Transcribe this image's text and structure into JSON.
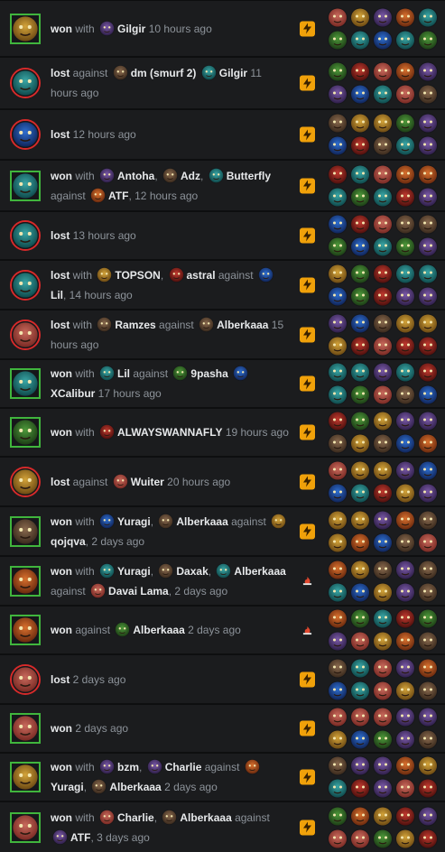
{
  "colors": {
    "won": "#40b53d",
    "lost": "#d62a2a",
    "bg": "#1b1c1e",
    "badge": "#f0a10a"
  },
  "matches": [
    {
      "result": "won",
      "avatar": "golden-monkey-hero",
      "badge": "lightning",
      "parts": [
        {
          "t": "won",
          "b": 1
        },
        {
          "t": " with "
        },
        {
          "i": "purple"
        },
        {
          "t": "Gilgir",
          "b": 1
        },
        {
          "t": " 10 hours ago"
        }
      ]
    },
    {
      "result": "lost",
      "avatar": "green-crab-hero",
      "badge": "lightning",
      "parts": [
        {
          "t": "lost",
          "b": 1
        },
        {
          "t": " against "
        },
        {
          "i": "brown"
        },
        {
          "t": "dm (smurf 2)",
          "b": 1
        },
        {
          "t": " "
        },
        {
          "i": "teal"
        },
        {
          "t": "Gilgir",
          "b": 1
        },
        {
          "t": " 11 hours ago"
        }
      ]
    },
    {
      "result": "lost",
      "avatar": "blue-mask-hero",
      "badge": "lightning",
      "parts": [
        {
          "t": "lost",
          "b": 1
        },
        {
          "t": " 12 hours ago"
        }
      ]
    },
    {
      "result": "won",
      "avatar": "teal-beast-hero",
      "badge": "lightning",
      "parts": [
        {
          "t": "won",
          "b": 1
        },
        {
          "t": " with "
        },
        {
          "i": "purple"
        },
        {
          "t": "Antoha",
          "b": 1
        },
        {
          "t": ", "
        },
        {
          "i": "brown"
        },
        {
          "t": "Adz",
          "b": 1
        },
        {
          "t": ", "
        },
        {
          "i": "teal"
        },
        {
          "t": "Butterfly",
          "b": 1
        },
        {
          "t": " against "
        },
        {
          "i": "orange"
        },
        {
          "t": "ATF",
          "b": 1
        },
        {
          "t": ", 12 hours ago"
        }
      ]
    },
    {
      "result": "lost",
      "avatar": "teal-spider-hero",
      "badge": "lightning",
      "parts": [
        {
          "t": "lost",
          "b": 1
        },
        {
          "t": " 13 hours ago"
        }
      ]
    },
    {
      "result": "lost",
      "avatar": "green-crab-hero",
      "badge": "lightning",
      "parts": [
        {
          "t": "lost",
          "b": 1
        },
        {
          "t": " with "
        },
        {
          "i": "gold"
        },
        {
          "t": "TOPSON",
          "b": 1
        },
        {
          "t": ", "
        },
        {
          "i": "red"
        },
        {
          "t": "astral",
          "b": 1
        },
        {
          "t": " against "
        },
        {
          "i": "blue"
        },
        {
          "t": "Lil",
          "b": 1
        },
        {
          "t": ", 14 hours ago"
        }
      ]
    },
    {
      "result": "lost",
      "avatar": "pink-maw-hero",
      "badge": "lightning",
      "parts": [
        {
          "t": "lost",
          "b": 1
        },
        {
          "t": " with "
        },
        {
          "i": "brown"
        },
        {
          "t": "Ramzes",
          "b": 1
        },
        {
          "t": " against "
        },
        {
          "i": "brown"
        },
        {
          "t": "Alberkaaa",
          "b": 1
        },
        {
          "t": " 15 hours ago"
        }
      ]
    },
    {
      "result": "won",
      "avatar": "green-crab-hero",
      "badge": "lightning",
      "parts": [
        {
          "t": "won",
          "b": 1
        },
        {
          "t": " with "
        },
        {
          "i": "teal"
        },
        {
          "t": "Lil",
          "b": 1
        },
        {
          "t": " against "
        },
        {
          "i": "green"
        },
        {
          "t": "9pasha",
          "b": 1
        },
        {
          "t": " "
        },
        {
          "i": "blue"
        },
        {
          "t": "XCalibur",
          "b": 1
        },
        {
          "t": " 17 hours ago"
        }
      ]
    },
    {
      "result": "won",
      "avatar": "green-mask-hero",
      "badge": "lightning",
      "parts": [
        {
          "t": "won",
          "b": 1
        },
        {
          "t": " with "
        },
        {
          "i": "red"
        },
        {
          "t": "ALWAYSWANNAFLY",
          "b": 1
        },
        {
          "t": " 19 hours ago"
        }
      ]
    },
    {
      "result": "lost",
      "avatar": "golden-monkey-hero",
      "badge": "lightning",
      "parts": [
        {
          "t": "lost",
          "b": 1
        },
        {
          "t": " against "
        },
        {
          "i": "pink"
        },
        {
          "t": "Wuiter",
          "b": 1
        },
        {
          "t": " 20 hours ago"
        }
      ]
    },
    {
      "result": "won",
      "avatar": "helmet-hero",
      "badge": "lightning",
      "parts": [
        {
          "t": "won",
          "b": 1
        },
        {
          "t": " with "
        },
        {
          "i": "blue"
        },
        {
          "t": "Yuragi",
          "b": 1
        },
        {
          "t": ", "
        },
        {
          "i": "brown"
        },
        {
          "t": "Alberkaaa",
          "b": 1
        },
        {
          "t": " against "
        },
        {
          "i": "gold"
        },
        {
          "t": "qojqva",
          "b": 1
        },
        {
          "t": ", 2 days ago"
        }
      ]
    },
    {
      "result": "won",
      "avatar": "elf-hero",
      "badge": "fire",
      "parts": [
        {
          "t": "won",
          "b": 1
        },
        {
          "t": " with "
        },
        {
          "i": "teal"
        },
        {
          "t": "Yuragi",
          "b": 1
        },
        {
          "t": ", "
        },
        {
          "i": "brown"
        },
        {
          "t": "Daxak",
          "b": 1
        },
        {
          "t": ", "
        },
        {
          "i": "teal"
        },
        {
          "t": "Alberkaaa",
          "b": 1
        },
        {
          "t": " against "
        },
        {
          "i": "pink"
        },
        {
          "t": "Davai Lama",
          "b": 1
        },
        {
          "t": ", 2 days ago"
        }
      ]
    },
    {
      "result": "won",
      "avatar": "elf-hero",
      "badge": "fire",
      "parts": [
        {
          "t": "won",
          "b": 1
        },
        {
          "t": " against "
        },
        {
          "i": "green"
        },
        {
          "t": "Alberkaaa",
          "b": 1
        },
        {
          "t": " 2 days ago"
        }
      ]
    },
    {
      "result": "lost",
      "avatar": "pink-maw-hero",
      "badge": "lightning",
      "parts": [
        {
          "t": "lost",
          "b": 1
        },
        {
          "t": " 2 days ago"
        }
      ]
    },
    {
      "result": "won",
      "avatar": "pink-maw-hero",
      "badge": "lightning",
      "parts": [
        {
          "t": "won",
          "b": 1
        },
        {
          "t": " 2 days ago"
        }
      ]
    },
    {
      "result": "won",
      "avatar": "golden-monkey-hero",
      "badge": "lightning",
      "parts": [
        {
          "t": "won",
          "b": 1
        },
        {
          "t": " with "
        },
        {
          "i": "purple"
        },
        {
          "t": "bzm",
          "b": 1
        },
        {
          "t": ", "
        },
        {
          "i": "purple"
        },
        {
          "t": "Charlie",
          "b": 1
        },
        {
          "t": " against "
        },
        {
          "i": "orange"
        },
        {
          "t": "Yuragi",
          "b": 1
        },
        {
          "t": ", "
        },
        {
          "i": "brown"
        },
        {
          "t": "Alberkaaa",
          "b": 1
        },
        {
          "t": " 2 days ago"
        }
      ]
    },
    {
      "result": "won",
      "avatar": "pink-maw-hero",
      "badge": "lightning",
      "parts": [
        {
          "t": "won",
          "b": 1
        },
        {
          "t": " with "
        },
        {
          "i": "pink"
        },
        {
          "t": "Charlie",
          "b": 1
        },
        {
          "t": ", "
        },
        {
          "i": "brown"
        },
        {
          "t": "Alberkaaa",
          "b": 1
        },
        {
          "t": " against "
        },
        {
          "i": "purple"
        },
        {
          "t": "ATF",
          "b": 1
        },
        {
          "t": ", 3 days ago"
        }
      ]
    }
  ],
  "hero_grids": [
    [
      "pink",
      "gold",
      "purple",
      "orange",
      "teal",
      "green",
      "teal",
      "blue",
      "teal",
      "green"
    ],
    [
      "green",
      "red",
      "pink",
      "orange",
      "purple",
      "purple",
      "blue",
      "teal",
      "pink",
      "brown"
    ],
    [
      "brown",
      "gold",
      "gold",
      "green",
      "purple",
      "blue",
      "red",
      "brown",
      "teal",
      "purple"
    ],
    [
      "red",
      "teal",
      "pink",
      "orange",
      "orange",
      "teal",
      "green",
      "teal",
      "red",
      "purple"
    ],
    [
      "blue",
      "red",
      "pink",
      "brown",
      "brown",
      "green",
      "blue",
      "teal",
      "green",
      "purple"
    ],
    [
      "gold",
      "green",
      "red",
      "teal",
      "teal",
      "blue",
      "green",
      "red",
      "purple",
      "purple"
    ],
    [
      "purple",
      "blue",
      "brown",
      "gold",
      "gold",
      "gold",
      "red",
      "pink",
      "red",
      "red"
    ],
    [
      "teal",
      "teal",
      "purple",
      "teal",
      "red",
      "teal",
      "green",
      "pink",
      "brown",
      "blue"
    ],
    [
      "red",
      "green",
      "gold",
      "purple",
      "purple",
      "brown",
      "gold",
      "brown",
      "blue",
      "orange"
    ],
    [
      "pink",
      "gold",
      "gold",
      "purple",
      "blue",
      "blue",
      "teal",
      "red",
      "gold",
      "purple"
    ],
    [
      "gold",
      "gold",
      "purple",
      "orange",
      "brown",
      "gold",
      "orange",
      "blue",
      "brown",
      "pink"
    ],
    [
      "orange",
      "gold",
      "brown",
      "purple",
      "brown",
      "teal",
      "blue",
      "gold",
      "purple",
      "brown"
    ],
    [
      "orange",
      "green",
      "teal",
      "red",
      "green",
      "purple",
      "pink",
      "gold",
      "orange",
      "brown"
    ],
    [
      "brown",
      "teal",
      "pink",
      "purple",
      "orange",
      "blue",
      "teal",
      "pink",
      "gold",
      "brown"
    ],
    [
      "pink",
      "pink",
      "pink",
      "purple",
      "purple",
      "gold",
      "blue",
      "green",
      "purple",
      "brown"
    ],
    [
      "brown",
      "purple",
      "purple",
      "orange",
      "gold",
      "teal",
      "red",
      "purple",
      "pink",
      "red"
    ],
    [
      "green",
      "orange",
      "gold",
      "red",
      "purple",
      "pink",
      "pink",
      "green",
      "gold",
      "red"
    ]
  ]
}
